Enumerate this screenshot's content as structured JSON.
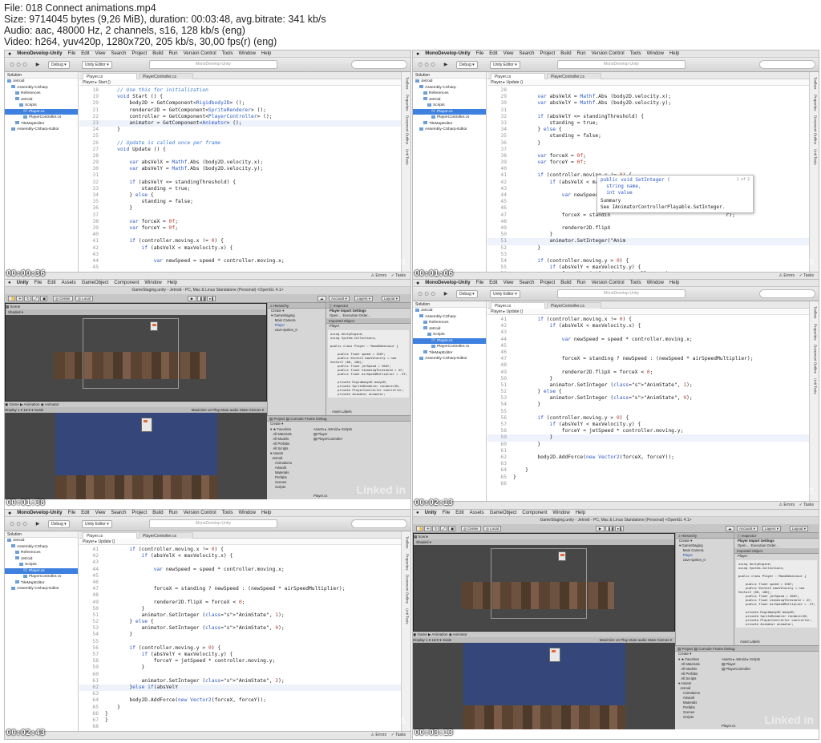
{
  "header": {
    "line1": "File: 018 Connect animations.mp4",
    "line2": "Size: 9714045 bytes (9,26 MiB), duration: 00:03:48, avg.bitrate: 341 kb/s",
    "line3": "Audio: aac, 48000 Hz, 2 channels, s16, 128 kb/s (eng)",
    "line4": "Video: h264, yuv420p, 1280x720, 205 kb/s, 30,00 fps(r) (eng)"
  },
  "md": {
    "app": "MonoDevelop-Unity",
    "menu": [
      "File",
      "Edit",
      "View",
      "Search",
      "Project",
      "Build",
      "Run",
      "Version Control",
      "Tools",
      "Window",
      "Help"
    ],
    "config": "Debug",
    "target": "Unity Editor",
    "field": "MonoDevelop-Unity",
    "solution_header": "Solution",
    "tree": [
      {
        "label": "Jetroid",
        "indent": 0,
        "sel": false
      },
      {
        "label": "Assembly-CSharp",
        "indent": 1,
        "sel": false
      },
      {
        "label": "References",
        "indent": 2,
        "sel": false
      },
      {
        "label": "Jetroid",
        "indent": 2,
        "sel": false
      },
      {
        "label": "Scripts",
        "indent": 3,
        "sel": false
      },
      {
        "label": "Player.cs",
        "indent": 4,
        "sel": true
      },
      {
        "label": "PlayerController.cs",
        "indent": 4,
        "sel": false
      },
      {
        "label": "TileMapEditor",
        "indent": 2,
        "sel": false
      },
      {
        "label": "Assembly-CSharp-Editor",
        "indent": 1,
        "sel": false
      }
    ],
    "tab1": "Player.cs",
    "tab2": "PlayerController.cs",
    "side": [
      "Toolbox",
      "Properties",
      "Document Outline",
      "Unit Tests"
    ],
    "status_errors": "Errors",
    "status_tasks": "Tasks"
  },
  "unity": {
    "app": "Unity",
    "menu": [
      "File",
      "Edit",
      "Assets",
      "GameObject",
      "Component",
      "Window",
      "Help"
    ],
    "title": "GameStaging.unity - Jetroid - PC, Mac & Linux Standalone (Personal) <OpenGL 4.1>",
    "center": "Center",
    "local": "Local",
    "account": "Account",
    "layers": "Layers",
    "layout": "Layout",
    "scene_tab": "Scene",
    "game_tab": "Game",
    "animation_tab": "Animation",
    "animator_tab": "Animator",
    "shaded": "Shaded",
    "display": "Display 1",
    "aspect": "16:9",
    "scale": "Scale",
    "maximize": "Maximize on Play",
    "mute": "Mute audio",
    "stats": "Stats",
    "gizmos": "Gizmos",
    "hierarchy": "Hierarchy",
    "create": "Create",
    "hier_items": [
      "GameStaging",
      "Main Camera",
      "Player",
      "cave-sprites_0"
    ],
    "inspector": "Inspector",
    "import_settings": "Player Import Settings",
    "open": "Open...",
    "exec_order": "Execution Order...",
    "imported": "Imported Object",
    "imported_name": "Player",
    "preview_code": "using UnityEngine;\nusing System.Collections;\n\npublic class Player : MonoBehaviour {\n\n    public float speed = 150f;\n    public Vector2 maxVelocity = new\nVector2 (60, 100);\n    public float jetSpeed = 200f;\n    public float standingThreshold = 4f;\n    public float airSpeedMultiplier = .3f;\n\n    private Rigidbody2D body2D;\n    private SpriteRenderer renderer2D;\n    private PlayerController controller;\n    private Animator animator;",
    "asset_labels": "Asset Labels",
    "project": "Project",
    "console": "Console",
    "frame_debug": "Frame Debug",
    "fav_header": "Favorites",
    "favorites": [
      "All Materials",
      "All Models",
      "All Prefabs",
      "All Scripts"
    ],
    "assets_header": "Assets",
    "assets": [
      "Jetroid",
      "Animations",
      "Artwork",
      "Materials",
      "Prefabs",
      "Scenes",
      "Scripts"
    ],
    "breadcrumb": "Assets ▸ Jetroid ▸ Scripts",
    "files": [
      "Player",
      "PlayerController"
    ],
    "footer": "Player.cs"
  },
  "tiles": [
    {
      "time": "00:00:36",
      "path": "Player ▸ Start ()"
    },
    {
      "time": "00:01:06",
      "path": "Player ▸ Update ()"
    },
    {
      "time": "00:01:38"
    },
    {
      "time": "00:02:13",
      "path": "Player ▸ Update ()"
    },
    {
      "time": "00:02:43",
      "path": "Player ▸ Update ()"
    },
    {
      "time": "00:03:13"
    }
  ],
  "code1": [
    [
      "18",
      "    // Use this for initialization"
    ],
    [
      "19",
      "    void Start () {"
    ],
    [
      "20",
      "        body2D = GetComponent<Rigidbody2D> ();"
    ],
    [
      "21",
      "        renderer2D = GetComponent<SpriteRenderer> ();"
    ],
    [
      "22",
      "        controller = GetComponent<PlayerController> ();"
    ],
    [
      "23",
      "        animator = GetComponent<Animator> ();"
    ],
    [
      "24",
      "    }"
    ],
    [
      "25",
      ""
    ],
    [
      "26",
      "    // Update is called once per frame"
    ],
    [
      "27",
      "    void Update () {"
    ],
    [
      "28",
      ""
    ],
    [
      "29",
      "        var absVelX = Mathf.Abs (body2D.velocity.x);"
    ],
    [
      "30",
      "        var absVelY = Mathf.Abs (body2D.velocity.y);"
    ],
    [
      "31",
      ""
    ],
    [
      "32",
      "        if (absVelY <= standingThreshold) {"
    ],
    [
      "33",
      "            standing = true;"
    ],
    [
      "34",
      "        } else {"
    ],
    [
      "35",
      "            standing = false;"
    ],
    [
      "36",
      "        }"
    ],
    [
      "37",
      ""
    ],
    [
      "38",
      "        var forceX = 0f;"
    ],
    [
      "39",
      "        var forceY = 0f;"
    ],
    [
      "40",
      ""
    ],
    [
      "41",
      "        if (controller.moving.x != 0) {"
    ],
    [
      "42",
      "            if (absVelX < maxVelocity.x) {"
    ],
    [
      "43",
      ""
    ],
    [
      "44",
      "                var newSpeed = speed * controller.moving.x;"
    ],
    [
      "45",
      ""
    ]
  ],
  "code2": [
    [
      "28",
      ""
    ],
    [
      "29",
      "        var absVelX = Mathf.Abs (body2D.velocity.x);"
    ],
    [
      "30",
      "        var absVelY = Mathf.Abs (body2D.velocity.y);"
    ],
    [
      "31",
      ""
    ],
    [
      "32",
      "        if (absVelY <= standingThreshold) {"
    ],
    [
      "33",
      "            standing = true;"
    ],
    [
      "34",
      "        } else {"
    ],
    [
      "35",
      "            standing = false;"
    ],
    [
      "36",
      "        }"
    ],
    [
      "37",
      ""
    ],
    [
      "38",
      "        var forceX = 0f;"
    ],
    [
      "39",
      "        var forceY = 0f;"
    ],
    [
      "40",
      ""
    ],
    [
      "41",
      "        if (controller.moving.x != 0) {"
    ],
    [
      "42",
      "            if (absVelX < maxVelocity.x) {"
    ],
    [
      "43",
      ""
    ],
    [
      "44",
      "                var newSpeed = s"
    ],
    [
      "45",
      ""
    ],
    [
      "46",
      ""
    ],
    [
      "47",
      "                forceX = standin                                      r);"
    ],
    [
      "48",
      ""
    ],
    [
      "49",
      "                renderer2D.flipX"
    ],
    [
      "50",
      "            }"
    ],
    [
      "51",
      "            animator.SetInteger(\"Anim"
    ],
    [
      "52",
      "        }"
    ],
    [
      "53",
      ""
    ],
    [
      "54",
      "        if (controller.moving.y > 0) {"
    ],
    [
      "55",
      "            if (absVelY < maxVelocity.y) {"
    ],
    [
      "56",
      "                forceY = jetSpeed * controller.moving.y;"
    ]
  ],
  "tooltip2": {
    "sig": "public void SetInteger (\n  string name,\n  int value",
    "count": "1 of 2",
    "summary": "Summary\nSee IAnimatorControllerPlayable.SetInteger."
  },
  "code4": [
    [
      "41",
      "        if (controller.moving.x != 0) {"
    ],
    [
      "42",
      "            if (absVelX < maxVelocity.x) {"
    ],
    [
      "43",
      ""
    ],
    [
      "44",
      "                var newSpeed = speed * controller.moving.x;"
    ],
    [
      "45",
      ""
    ],
    [
      "46",
      ""
    ],
    [
      "47",
      "                forceX = standing ? newSpeed : (newSpeed * airSpeedMultiplier);"
    ],
    [
      "48",
      ""
    ],
    [
      "49",
      "                renderer2D.flipX = forceX < 0;"
    ],
    [
      "50",
      "            }"
    ],
    [
      "51",
      "            animator.SetInteger (\"AnimState\", 1);"
    ],
    [
      "52",
      "        } else {"
    ],
    [
      "53",
      "            animator.SetInteger (\"AnimState\", 0);"
    ],
    [
      "54",
      "        }"
    ],
    [
      "55",
      ""
    ],
    [
      "56",
      "        if (controller.moving.y > 0) {"
    ],
    [
      "57",
      "            if (absVelY < maxVelocity.y) {"
    ],
    [
      "58",
      "                forceY = jetSpeed * controller.moving.y;"
    ],
    [
      "59",
      "            }"
    ],
    [
      "60",
      "        }"
    ],
    [
      "61",
      ""
    ],
    [
      "62",
      "        body2D.AddForce(new Vector2(forceX, forceY));"
    ],
    [
      "63",
      ""
    ],
    [
      "64",
      "    }"
    ],
    [
      "65",
      "}"
    ],
    [
      "66",
      ""
    ]
  ],
  "code5": [
    [
      "41",
      "        if (controller.moving.x != 0) {"
    ],
    [
      "42",
      "            if (absVelX < maxVelocity.x) {"
    ],
    [
      "43",
      ""
    ],
    [
      "44",
      "                var newSpeed = speed * controller.moving.x;"
    ],
    [
      "45",
      ""
    ],
    [
      "46",
      ""
    ],
    [
      "47",
      "                forceX = standing ? newSpeed : (newSpeed * airSpeedMultiplier);"
    ],
    [
      "48",
      ""
    ],
    [
      "49",
      "                renderer2D.flipX = forceX < 0;"
    ],
    [
      "50",
      "            }"
    ],
    [
      "51",
      "            animator.SetInteger (\"AnimState\", 1);"
    ],
    [
      "52",
      "        } else {"
    ],
    [
      "53",
      "            animator.SetInteger (\"AnimState\", 0);"
    ],
    [
      "54",
      "        }"
    ],
    [
      "55",
      ""
    ],
    [
      "56",
      "        if (controller.moving.y > 0) {"
    ],
    [
      "57",
      "            if (absVelY < maxVelocity.y) {"
    ],
    [
      "58",
      "                forceY = jetSpeed * controller.moving.y;"
    ],
    [
      "59",
      "            }"
    ],
    [
      "60",
      ""
    ],
    [
      "61",
      "            animator.SetInteger (\"AnimState\", 2);"
    ],
    [
      "62",
      "        }else if(absVelY"
    ],
    [
      "63",
      ""
    ],
    [
      "64",
      "        body2D.AddForce(new Vector2(forceX, forceY));"
    ],
    [
      "65",
      "    }"
    ],
    [
      "66",
      "}"
    ],
    [
      "67",
      "}"
    ],
    [
      "68",
      ""
    ]
  ],
  "watermark": "Linked in"
}
